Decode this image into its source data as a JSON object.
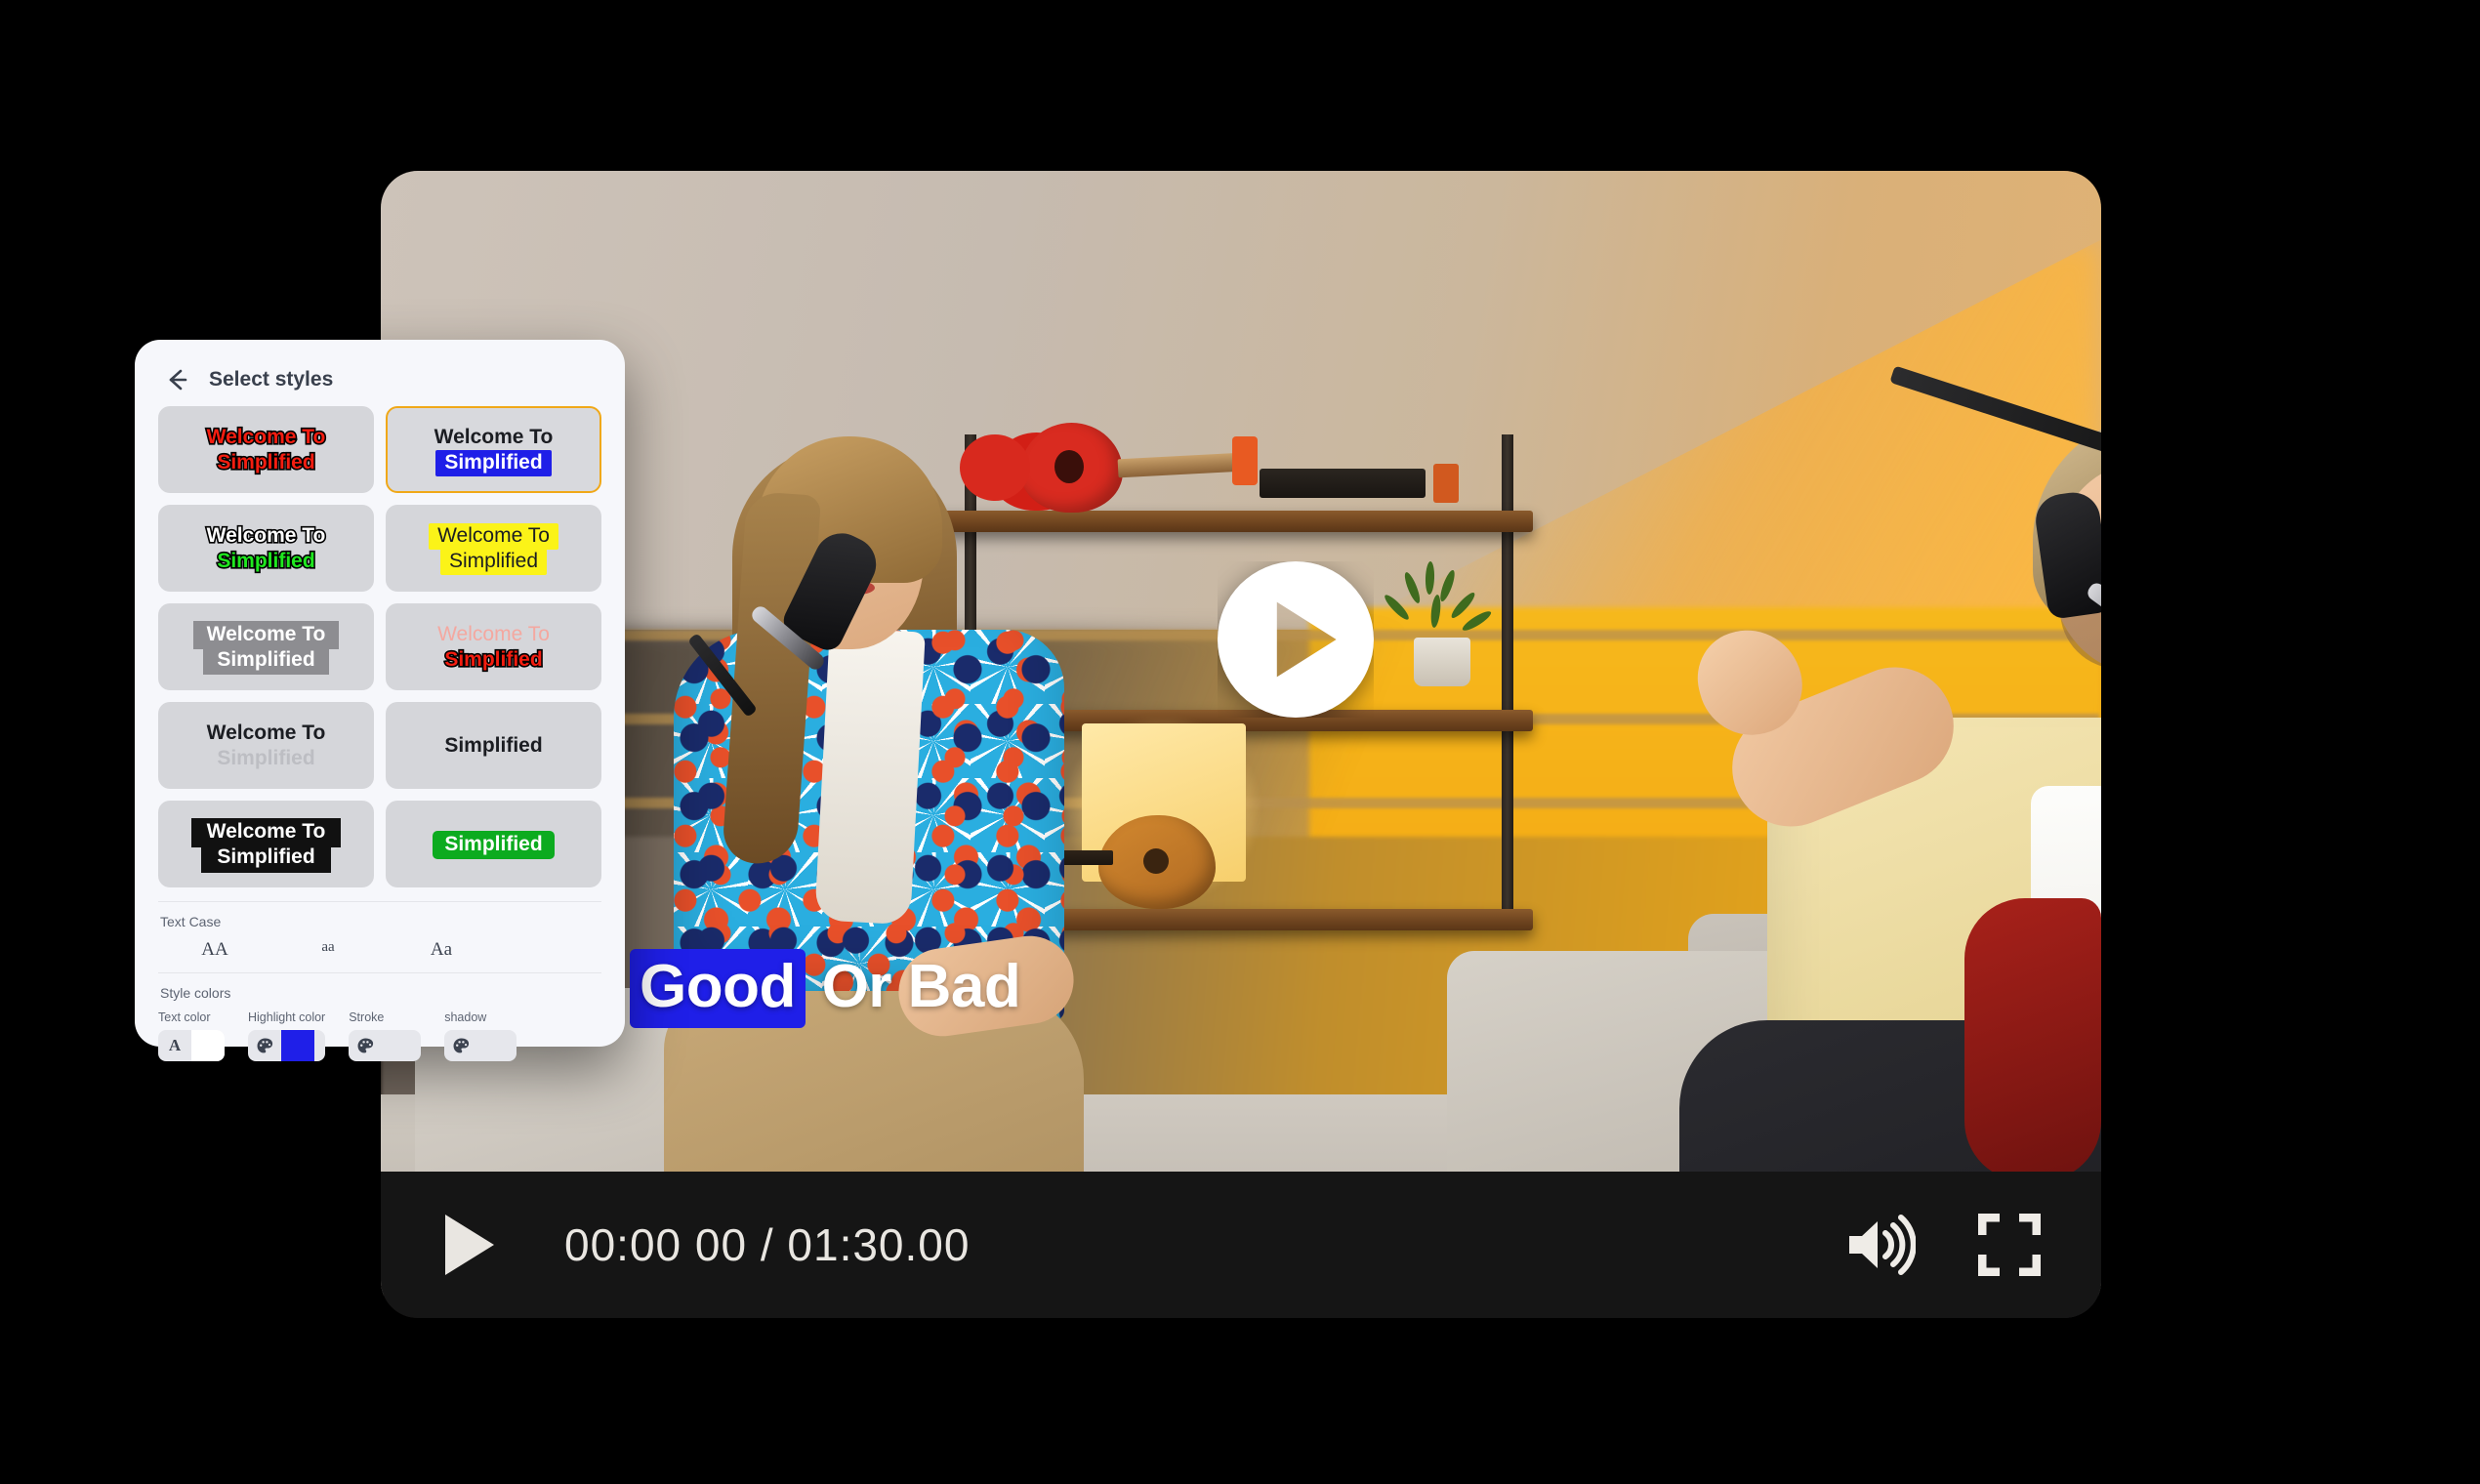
{
  "styles_panel": {
    "back_icon": "back-arrow-icon",
    "title": "Select styles",
    "style_cards": [
      {
        "id": "red-stroke",
        "line1": "Welcome To",
        "line2": "Simplified",
        "selected": false
      },
      {
        "id": "blue-highlight",
        "line1": "Welcome To",
        "line2": "Simplified",
        "selected": true
      },
      {
        "id": "white-green",
        "line1": "Welcome To",
        "line2": "Simplified",
        "selected": false
      },
      {
        "id": "yellow-highlight",
        "line1": "Welcome To",
        "line2": "Simplified",
        "selected": false
      },
      {
        "id": "gray-box",
        "line1": "Welcome To",
        "line2": "Simplified",
        "selected": false
      },
      {
        "id": "pink-red",
        "line1": "Welcome To",
        "line2": "Simplified",
        "selected": false
      },
      {
        "id": "faded",
        "line1": "Welcome To",
        "line2": "Simplified",
        "selected": false
      },
      {
        "id": "plain-bold",
        "line1": "",
        "line2": "Simplified",
        "selected": false
      },
      {
        "id": "black-box",
        "line1": "Welcome To",
        "line2": "Simplified",
        "selected": false
      },
      {
        "id": "green-box",
        "line1": "",
        "line2": "Simplified",
        "selected": false
      }
    ],
    "text_case": {
      "label": "Text Case",
      "options": [
        "AA",
        "aa",
        "Aa"
      ]
    },
    "style_colors": {
      "label": "Style colors",
      "items": [
        {
          "label": "Text color",
          "icon": "letter-a-icon",
          "swatch": "#ffffff"
        },
        {
          "label": "Highlight color",
          "icon": "palette-icon",
          "swatch": "#1f1fe8"
        },
        {
          "label": "Stroke",
          "icon": "palette-icon",
          "swatch": ""
        },
        {
          "label": "shadow",
          "icon": "palette-icon",
          "swatch": ""
        }
      ]
    }
  },
  "player": {
    "caption": {
      "highlighted_word": "Good",
      "rest": " Or Bad",
      "highlight_color": "#1f1fe8"
    },
    "play_overlay_icon": "play-circle-icon",
    "controls": {
      "play_icon": "play-icon",
      "time_display": "00:00 00 / 01:30.00",
      "volume_icon": "volume-high-icon",
      "fullscreen_icon": "fullscreen-icon"
    }
  }
}
